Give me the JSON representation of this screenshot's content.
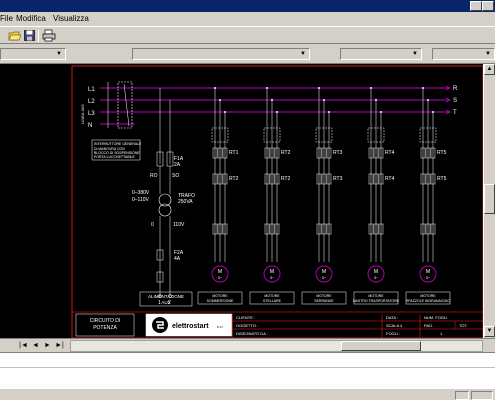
{
  "menu": {
    "file": "File",
    "modifica": "Modifica",
    "visualizza": "Visualizza"
  },
  "window": {
    "help_label": "?"
  },
  "drawing": {
    "phases": [
      "L1",
      "L2",
      "L3",
      "N"
    ],
    "phase_labels_right": [
      "R",
      "S",
      "T"
    ],
    "line_label": "LINEA 4X6",
    "warning_box": [
      "INTERRUTTORE GENERALE",
      "DI MANOVRA CON",
      "BLOCCO DI SOSPENSIONE",
      "PORTA LUCCHETTABILE"
    ],
    "fuse_label": [
      "F1A",
      "2A"
    ],
    "trafo_label": [
      "TRAFO",
      "250VA"
    ],
    "trafo_primary": [
      "0–380V",
      "0–110V"
    ],
    "trafo_secondary": "110V",
    "ro": "RO",
    "so": "SO",
    "fuse2_label": [
      "F2A",
      "4A"
    ],
    "aux_labels": [
      "0",
      "1",
      "2"
    ],
    "aux_caption": [
      "ALIMENTAZIONE",
      "AUX"
    ],
    "feeders": [
      {
        "breaker": "Q1",
        "rt": "RT1",
        "rt2": "RT2",
        "caption": [
          "MOTORE",
          "SOMMERSIONE"
        ]
      },
      {
        "breaker": "Q2",
        "rt": "RT2",
        "rt2": "RT2",
        "caption": [
          "MOTORE",
          "STELLARE"
        ]
      },
      {
        "breaker": "Q3",
        "rt": "RT3",
        "rt2": "RT3",
        "caption": [
          "MOTORE",
          "SERRANDE"
        ]
      },
      {
        "breaker": "Q4",
        "rt": "RT4",
        "rt2": "RT4",
        "caption": [
          "MOTORE",
          "NASTRO TRASPORTATORE"
        ]
      },
      {
        "breaker": "Q5",
        "rt": "RT5",
        "rt2": "RT5",
        "caption": [
          "MOTORE",
          "SPAZZOLE INGRANAGGIO"
        ]
      }
    ],
    "motor_label": "M",
    "motor_phase": "3~",
    "title_block": {
      "left_caption": [
        "CIRCUITO DI",
        "POTENZA"
      ],
      "company": "elettrostart",
      "company_suffix": "s.r.l.",
      "cliente": "CLIENTE :",
      "oggetto": "OGGETTO :",
      "disegnato": "DISEGNATO DA :",
      "data": "DATA :",
      "scala": "SCALA :",
      "scala_val": "1",
      "fogli": "FOGLI :",
      "data_val": "",
      "num_fogli": "NUM. FOGLI",
      "pag": "PAG.",
      "tot": "TOT.",
      "pag_val": "1"
    }
  },
  "colors": {
    "canvas_bg": "#000000",
    "wire": "#c000c0",
    "line": "#ffffff",
    "red": "#ff3030",
    "frame": "#ff2020"
  }
}
